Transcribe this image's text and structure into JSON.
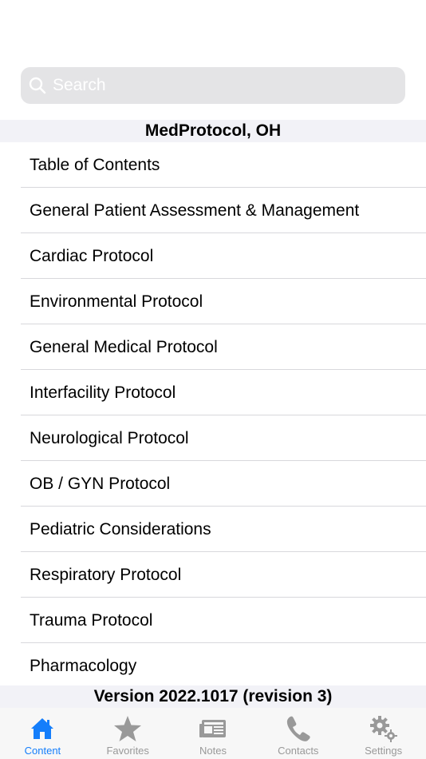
{
  "search": {
    "placeholder": "Search",
    "icon": "magnifying-glass-icon"
  },
  "section": {
    "title": "MedProtocol, OH"
  },
  "list": {
    "items": [
      "Table of Contents",
      "General Patient Assessment & Management",
      "Cardiac Protocol",
      "Environmental Protocol",
      "General Medical Protocol",
      "Interfacility Protocol",
      "Neurological Protocol",
      "OB / GYN Protocol",
      "Pediatric Considerations",
      "Respiratory Protocol",
      "Trauma Protocol",
      "Pharmacology"
    ]
  },
  "footer": {
    "version": "Version 2022.1017 (revision 3)"
  },
  "tabs": [
    {
      "label": "Content",
      "icon": "house-icon",
      "active": true
    },
    {
      "label": "Favorites",
      "icon": "star-icon",
      "active": false
    },
    {
      "label": "Notes",
      "icon": "newspaper-icon",
      "active": false
    },
    {
      "label": "Contacts",
      "icon": "phone-icon",
      "active": false
    },
    {
      "label": "Settings",
      "icon": "gear-icon",
      "active": false
    }
  ],
  "colors": {
    "accent": "#147efb",
    "inactive": "#999999",
    "search_bg": "#e4e4e6",
    "header_bg": "#f2f2f7"
  }
}
